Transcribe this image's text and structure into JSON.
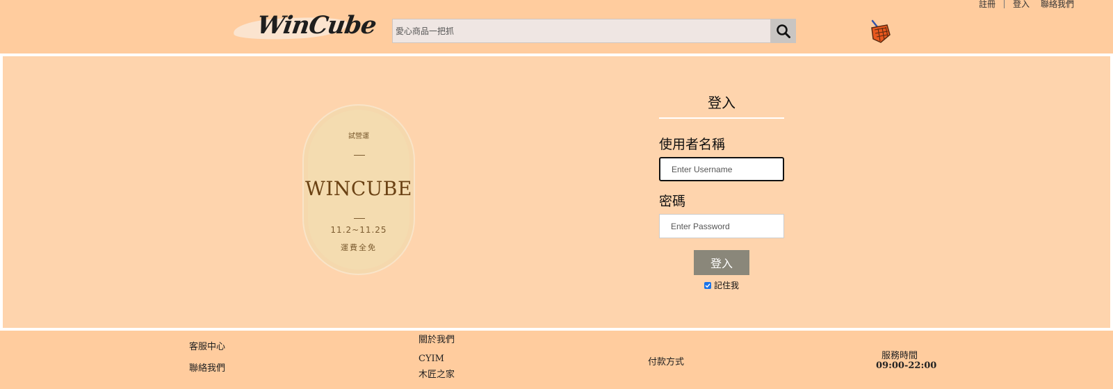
{
  "header": {
    "top_links": {
      "register": "註冊",
      "login": "登入",
      "contact": "聯絡我們"
    },
    "logo_text": "WinCube",
    "search_placeholder": "愛心商品一把抓",
    "search_icon": "search-icon",
    "cart_icon": "basket-icon"
  },
  "promo": {
    "top_text": "試營運",
    "brand": "WINCUBE",
    "dates": "11.2~11.25",
    "shipping": "運費全免"
  },
  "login": {
    "title": "登入",
    "username_label": "使用者名稱",
    "username_placeholder": "Enter Username",
    "password_label": "密碼",
    "password_placeholder": "Enter Password",
    "submit_label": "登入",
    "remember_label": "記住我",
    "remember_checked": true
  },
  "footer": {
    "service": {
      "title": "客服中心",
      "link": "聯絡我們"
    },
    "about": {
      "title": "關於我們",
      "item1": "CYIM",
      "item2": "木匠之家"
    },
    "payment": {
      "title": "付款方式"
    },
    "hours": {
      "title": "服務時間",
      "value": "09:00-22:00"
    }
  },
  "colors": {
    "header_bg": "#ffcc9e",
    "main_bg": "#fed4ad",
    "button_bg": "#8a877a",
    "cart_orange": "#e8581e"
  }
}
